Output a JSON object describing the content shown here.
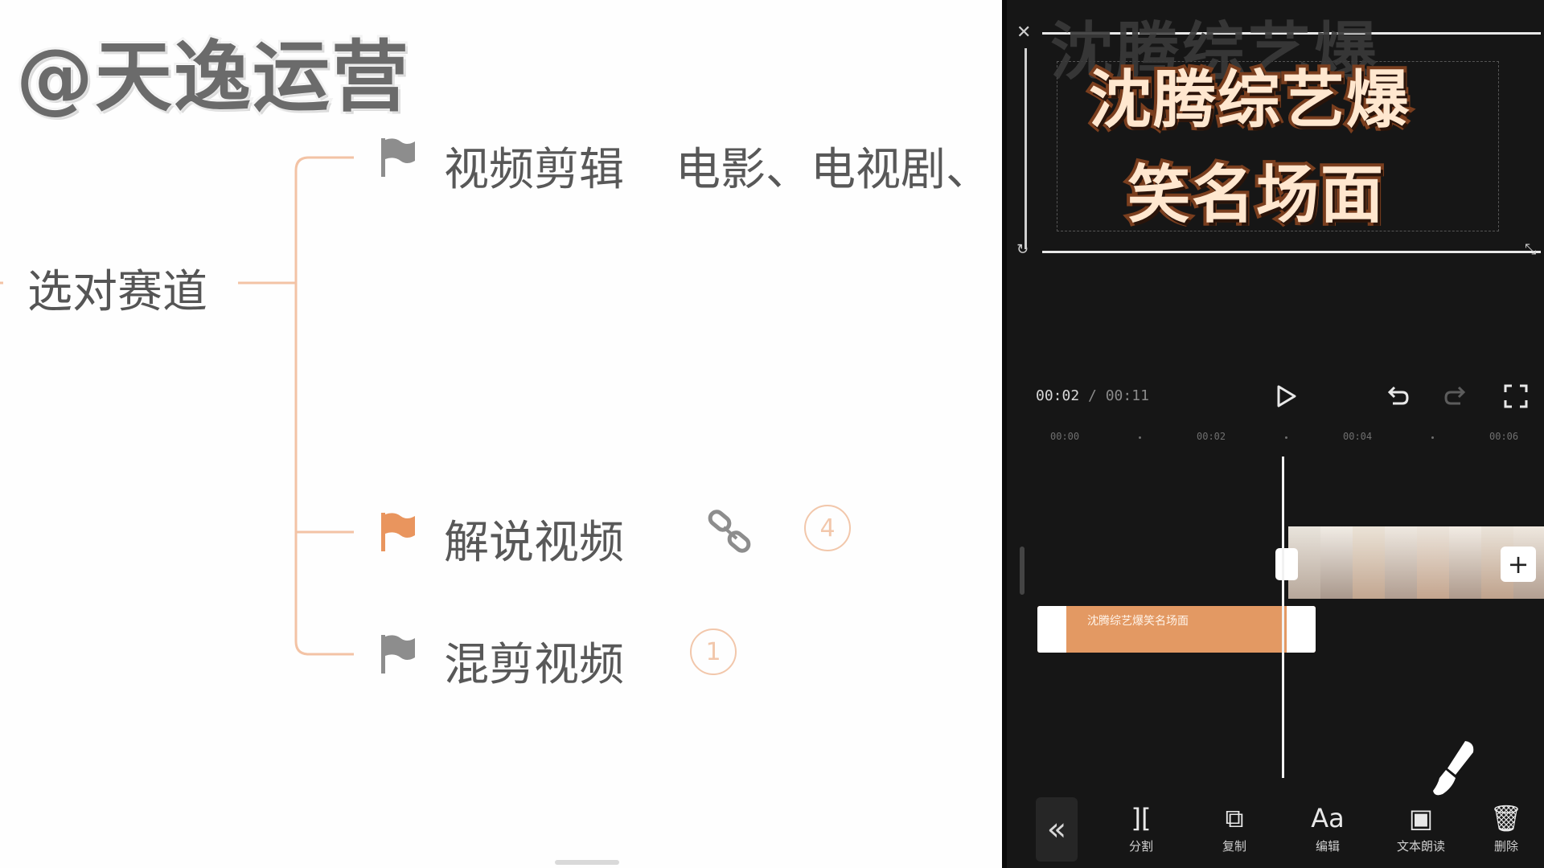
{
  "watermark": "@天逸运营",
  "mindmap": {
    "root": "选对赛道",
    "branches": [
      {
        "label": "视频剪辑",
        "extra": "电影、电视剧、",
        "flag_color": "#8d8d8d"
      },
      {
        "label": "解说视频",
        "badge": "4",
        "flag_color": "#e9955e"
      },
      {
        "label": "混剪视频",
        "badge": "1",
        "flag_color": "#8d8d8d"
      }
    ],
    "connector_color": "#f3c3a5"
  },
  "editor": {
    "title_line1": "沈腾综艺爆",
    "title_line2": "笑名场面",
    "title_back": "沈腾综艺爆",
    "time_current": "00:02",
    "time_total": "00:11",
    "ruler": [
      "00:00",
      "00:02",
      "00:04",
      "00:06"
    ],
    "text_clip_label": "沈腾综艺爆笑名场面",
    "accent": "#e39963",
    "tools": [
      {
        "glyph": "][",
        "label": "分割",
        "icon": "split-icon"
      },
      {
        "glyph": "⧉",
        "label": "复制",
        "icon": "copy-icon"
      },
      {
        "glyph": "Aa",
        "label": "编辑",
        "icon": "edit-text-icon"
      },
      {
        "glyph": "▣",
        "label": "文本朗读",
        "icon": "text-to-speech-icon"
      },
      {
        "glyph": "🗑",
        "label": "删除",
        "icon": "delete-icon"
      }
    ]
  }
}
